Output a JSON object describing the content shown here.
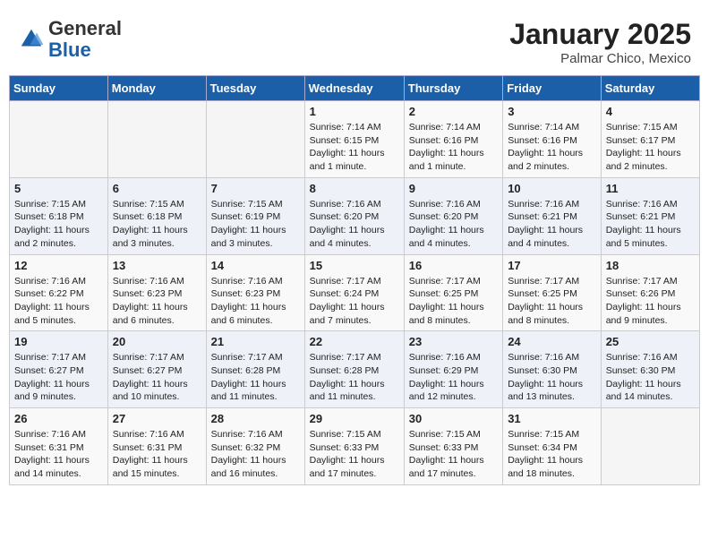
{
  "header": {
    "logo_general": "General",
    "logo_blue": "Blue",
    "month_year": "January 2025",
    "location": "Palmar Chico, Mexico"
  },
  "days_of_week": [
    "Sunday",
    "Monday",
    "Tuesday",
    "Wednesday",
    "Thursday",
    "Friday",
    "Saturday"
  ],
  "weeks": [
    [
      {
        "day": "",
        "info": ""
      },
      {
        "day": "",
        "info": ""
      },
      {
        "day": "",
        "info": ""
      },
      {
        "day": "1",
        "info": "Sunrise: 7:14 AM\nSunset: 6:15 PM\nDaylight: 11 hours and 1 minute."
      },
      {
        "day": "2",
        "info": "Sunrise: 7:14 AM\nSunset: 6:16 PM\nDaylight: 11 hours and 1 minute."
      },
      {
        "day": "3",
        "info": "Sunrise: 7:14 AM\nSunset: 6:16 PM\nDaylight: 11 hours and 2 minutes."
      },
      {
        "day": "4",
        "info": "Sunrise: 7:15 AM\nSunset: 6:17 PM\nDaylight: 11 hours and 2 minutes."
      }
    ],
    [
      {
        "day": "5",
        "info": "Sunrise: 7:15 AM\nSunset: 6:18 PM\nDaylight: 11 hours and 2 minutes."
      },
      {
        "day": "6",
        "info": "Sunrise: 7:15 AM\nSunset: 6:18 PM\nDaylight: 11 hours and 3 minutes."
      },
      {
        "day": "7",
        "info": "Sunrise: 7:15 AM\nSunset: 6:19 PM\nDaylight: 11 hours and 3 minutes."
      },
      {
        "day": "8",
        "info": "Sunrise: 7:16 AM\nSunset: 6:20 PM\nDaylight: 11 hours and 4 minutes."
      },
      {
        "day": "9",
        "info": "Sunrise: 7:16 AM\nSunset: 6:20 PM\nDaylight: 11 hours and 4 minutes."
      },
      {
        "day": "10",
        "info": "Sunrise: 7:16 AM\nSunset: 6:21 PM\nDaylight: 11 hours and 4 minutes."
      },
      {
        "day": "11",
        "info": "Sunrise: 7:16 AM\nSunset: 6:21 PM\nDaylight: 11 hours and 5 minutes."
      }
    ],
    [
      {
        "day": "12",
        "info": "Sunrise: 7:16 AM\nSunset: 6:22 PM\nDaylight: 11 hours and 5 minutes."
      },
      {
        "day": "13",
        "info": "Sunrise: 7:16 AM\nSunset: 6:23 PM\nDaylight: 11 hours and 6 minutes."
      },
      {
        "day": "14",
        "info": "Sunrise: 7:16 AM\nSunset: 6:23 PM\nDaylight: 11 hours and 6 minutes."
      },
      {
        "day": "15",
        "info": "Sunrise: 7:17 AM\nSunset: 6:24 PM\nDaylight: 11 hours and 7 minutes."
      },
      {
        "day": "16",
        "info": "Sunrise: 7:17 AM\nSunset: 6:25 PM\nDaylight: 11 hours and 8 minutes."
      },
      {
        "day": "17",
        "info": "Sunrise: 7:17 AM\nSunset: 6:25 PM\nDaylight: 11 hours and 8 minutes."
      },
      {
        "day": "18",
        "info": "Sunrise: 7:17 AM\nSunset: 6:26 PM\nDaylight: 11 hours and 9 minutes."
      }
    ],
    [
      {
        "day": "19",
        "info": "Sunrise: 7:17 AM\nSunset: 6:27 PM\nDaylight: 11 hours and 9 minutes."
      },
      {
        "day": "20",
        "info": "Sunrise: 7:17 AM\nSunset: 6:27 PM\nDaylight: 11 hours and 10 minutes."
      },
      {
        "day": "21",
        "info": "Sunrise: 7:17 AM\nSunset: 6:28 PM\nDaylight: 11 hours and 11 minutes."
      },
      {
        "day": "22",
        "info": "Sunrise: 7:17 AM\nSunset: 6:28 PM\nDaylight: 11 hours and 11 minutes."
      },
      {
        "day": "23",
        "info": "Sunrise: 7:16 AM\nSunset: 6:29 PM\nDaylight: 11 hours and 12 minutes."
      },
      {
        "day": "24",
        "info": "Sunrise: 7:16 AM\nSunset: 6:30 PM\nDaylight: 11 hours and 13 minutes."
      },
      {
        "day": "25",
        "info": "Sunrise: 7:16 AM\nSunset: 6:30 PM\nDaylight: 11 hours and 14 minutes."
      }
    ],
    [
      {
        "day": "26",
        "info": "Sunrise: 7:16 AM\nSunset: 6:31 PM\nDaylight: 11 hours and 14 minutes."
      },
      {
        "day": "27",
        "info": "Sunrise: 7:16 AM\nSunset: 6:31 PM\nDaylight: 11 hours and 15 minutes."
      },
      {
        "day": "28",
        "info": "Sunrise: 7:16 AM\nSunset: 6:32 PM\nDaylight: 11 hours and 16 minutes."
      },
      {
        "day": "29",
        "info": "Sunrise: 7:15 AM\nSunset: 6:33 PM\nDaylight: 11 hours and 17 minutes."
      },
      {
        "day": "30",
        "info": "Sunrise: 7:15 AM\nSunset: 6:33 PM\nDaylight: 11 hours and 17 minutes."
      },
      {
        "day": "31",
        "info": "Sunrise: 7:15 AM\nSunset: 6:34 PM\nDaylight: 11 hours and 18 minutes."
      },
      {
        "day": "",
        "info": ""
      }
    ]
  ]
}
